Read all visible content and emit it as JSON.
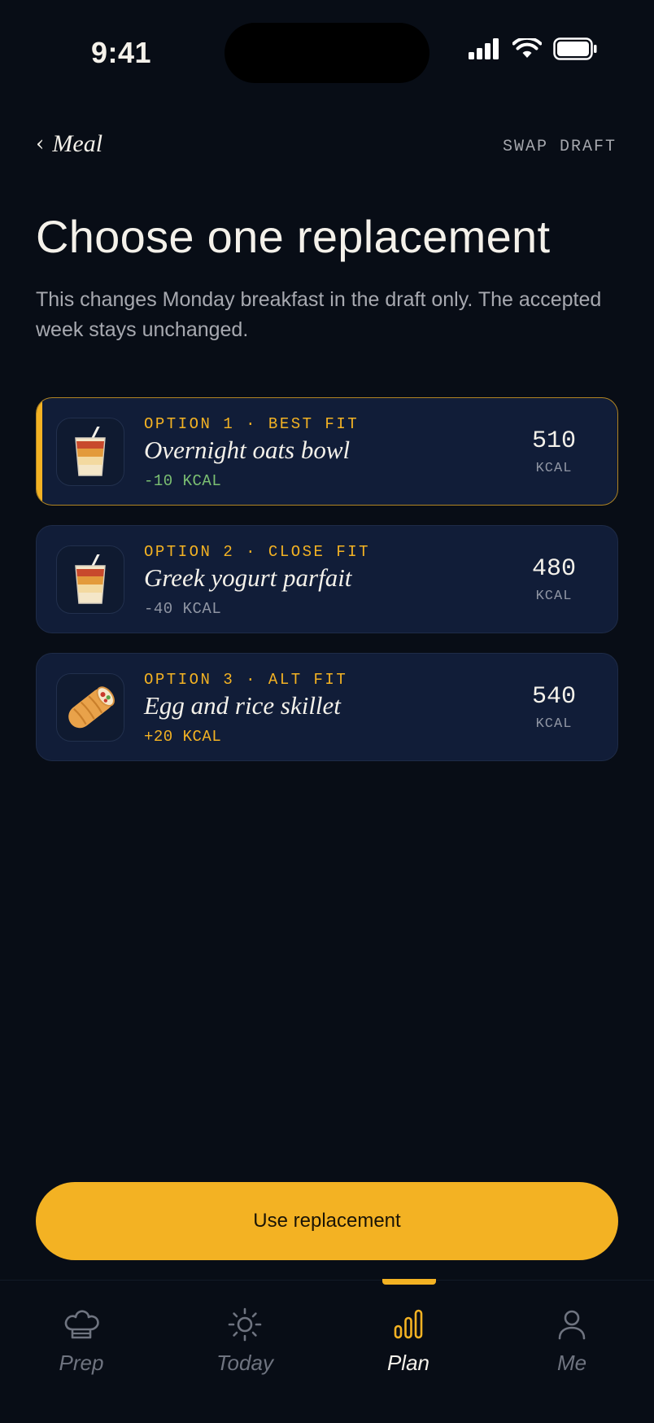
{
  "status_bar": {
    "time": "9:41"
  },
  "header": {
    "back_chevron": "‹",
    "back_label": "Meal",
    "right_label": "SWAP DRAFT"
  },
  "title": "Choose one replacement",
  "subtitle": "This changes Monday breakfast in the draft only. The accepted week stays unchanged.",
  "options": [
    {
      "label": "OPTION 1 · BEST FIT",
      "name": "Overnight oats bowl",
      "delta": "-10 KCAL",
      "delta_color": "#7bbf72",
      "kcal": "510",
      "unit": "KCAL",
      "icon": "layered-drink-icon",
      "selected": true
    },
    {
      "label": "OPTION 2 · CLOSE FIT",
      "name": "Greek yogurt parfait",
      "delta": "-40 KCAL",
      "delta_color": "#8f95a3",
      "kcal": "480",
      "unit": "KCAL",
      "icon": "layered-drink-icon",
      "selected": false
    },
    {
      "label": "OPTION 3 · ALT FIT",
      "name": "Egg and rice skillet",
      "delta": "+20 KCAL",
      "delta_color": "#f3b223",
      "kcal": "540",
      "unit": "KCAL",
      "icon": "burrito-icon",
      "selected": false
    }
  ],
  "cta": {
    "label": "Use replacement"
  },
  "tabs": [
    {
      "label": "Prep",
      "icon": "chef-hat-icon",
      "active": false
    },
    {
      "label": "Today",
      "icon": "sun-icon",
      "active": false
    },
    {
      "label": "Plan",
      "icon": "bar-chart-icon",
      "active": true
    },
    {
      "label": "Me",
      "icon": "person-icon",
      "active": false
    }
  ],
  "colors": {
    "accent": "#f3b223",
    "background": "#080d16",
    "card": "#111d38"
  }
}
